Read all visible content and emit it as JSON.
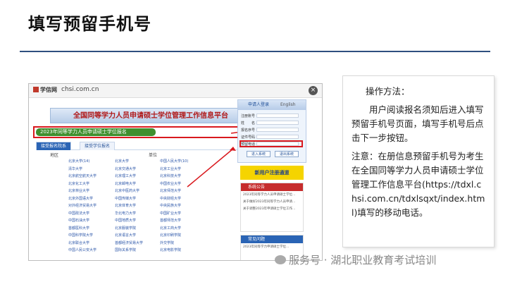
{
  "slide": {
    "title": "填写预留手机号"
  },
  "screenshot": {
    "brand": "学信网",
    "domain": "chsi.com.cn",
    "close_glyph": "×",
    "banner": "全国同等学力人员申请硕士学位管理工作信息平台",
    "green_bar": "2023年同等学力人员申请硕士学位报名",
    "tabs": [
      "接受报名院系",
      "接受学位报名"
    ],
    "table_headers": [
      "地区",
      "单位"
    ],
    "universities": [
      [
        "北京大学(14)",
        "北京大学",
        "中国人民大学(10)"
      ],
      [
        "清华大学",
        "北京交通大学",
        "北京工业大学"
      ],
      [
        "北京航空航天大学",
        "北京理工大学",
        "北京科技大学"
      ],
      [
        "北京化工大学",
        "北京邮电大学",
        "中国农业大学"
      ],
      [
        "北京林业大学",
        "北京中医药大学",
        "北京师范大学"
      ],
      [
        "北京外国语大学",
        "中国传媒大学",
        "中央财经大学"
      ],
      [
        "对外经济贸易大学",
        "北京体育大学",
        "中央民族大学"
      ],
      [
        "中国政法大学",
        "华北电力大学",
        "中国矿业大学"
      ],
      [
        "中国石油大学",
        "中国地质大学",
        "首都师范大学"
      ],
      [
        "首都医科大学",
        "北京服装学院",
        "北京工商大学"
      ],
      [
        "中国科学院大学",
        "北京语言大学",
        "北京印刷学院"
      ],
      [
        "北京联合大学",
        "首都经济贸易大学",
        "外交学院"
      ],
      [
        "中国人民公安大学",
        "国际关系学院",
        "北京电影学院"
      ]
    ],
    "login": {
      "title": "申请人登录",
      "english": "English",
      "rows": [
        "注册账号",
        "姓　　名",
        "报名序号",
        "预留电话",
        "证件号码"
      ],
      "buttons": [
        "进入系统",
        "退出系统"
      ]
    },
    "yellow_notice": "新用户注册通道",
    "news": {
      "title": "系统公告",
      "items": [
        "2023年同等学力人员申请硕士学位…",
        "关于做好2023年同等学力人员申请…",
        "关于调整2023年申请硕士学位工作…"
      ]
    },
    "faq": {
      "title": "常见问题",
      "items": [
        "2023年同等学力申请硕士学位…"
      ]
    }
  },
  "panel": {
    "method_label": "操作方法：",
    "step_text": "用户阅读报名须知后进入填写预留手机号页面，填写手机号后点击下一步按钮。",
    "note_text": "注意：在册信息预留手机号为考生在全国同等学力人员申请硕士学位管理工作信息平台(https://tdxl.chsi.com.cn/tdxlsqxt/index.html)填写的移动电话。"
  },
  "watermark": {
    "text": "服务号 · 湖北职业教育考试培训"
  },
  "colors": {
    "title_rule": "#2f4f7f",
    "highlight_red": "#d9191e",
    "green_bar": "#3f8f2e",
    "notice_yellow": "#f5d400"
  }
}
